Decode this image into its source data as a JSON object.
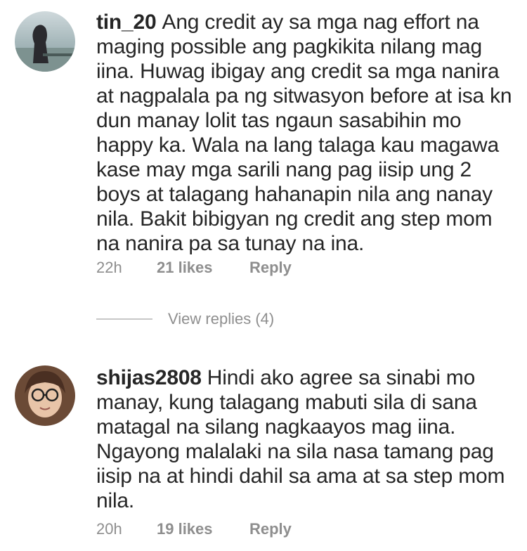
{
  "comments": [
    {
      "username": "tin_20",
      "text": "Ang credit ay sa mga nag effort na maging possible ang pagkikita nilang mag iina. Huwag ibigay ang credit sa mga nanira at nagpalala pa ng sitwasyon before at isa kn dun manay lolit tas ngaun sasabihin mo happy ka. Wala na lang talaga kau magawa kase may mga sarili nang pag iisip ung 2 boys at talagang hahanapin nila ang nanay nila. Bakit bibigyan ng credit ang step mom na nanira pa sa tunay na ina.",
      "time": "22h",
      "likes": "21 likes",
      "reply": "Reply",
      "view_replies": "View replies (4)"
    },
    {
      "username": "shijas2808",
      "text": "Hindi ako agree sa sinabi mo manay, kung talagang mabuti sila di sana matagal na silang nagkaayos mag iina. Ngayong malalaki na sila nasa tamang pag iisip na at hindi dahil sa ama at sa step mom nila.",
      "time": "20h",
      "likes": "19 likes",
      "reply": "Reply"
    }
  ]
}
